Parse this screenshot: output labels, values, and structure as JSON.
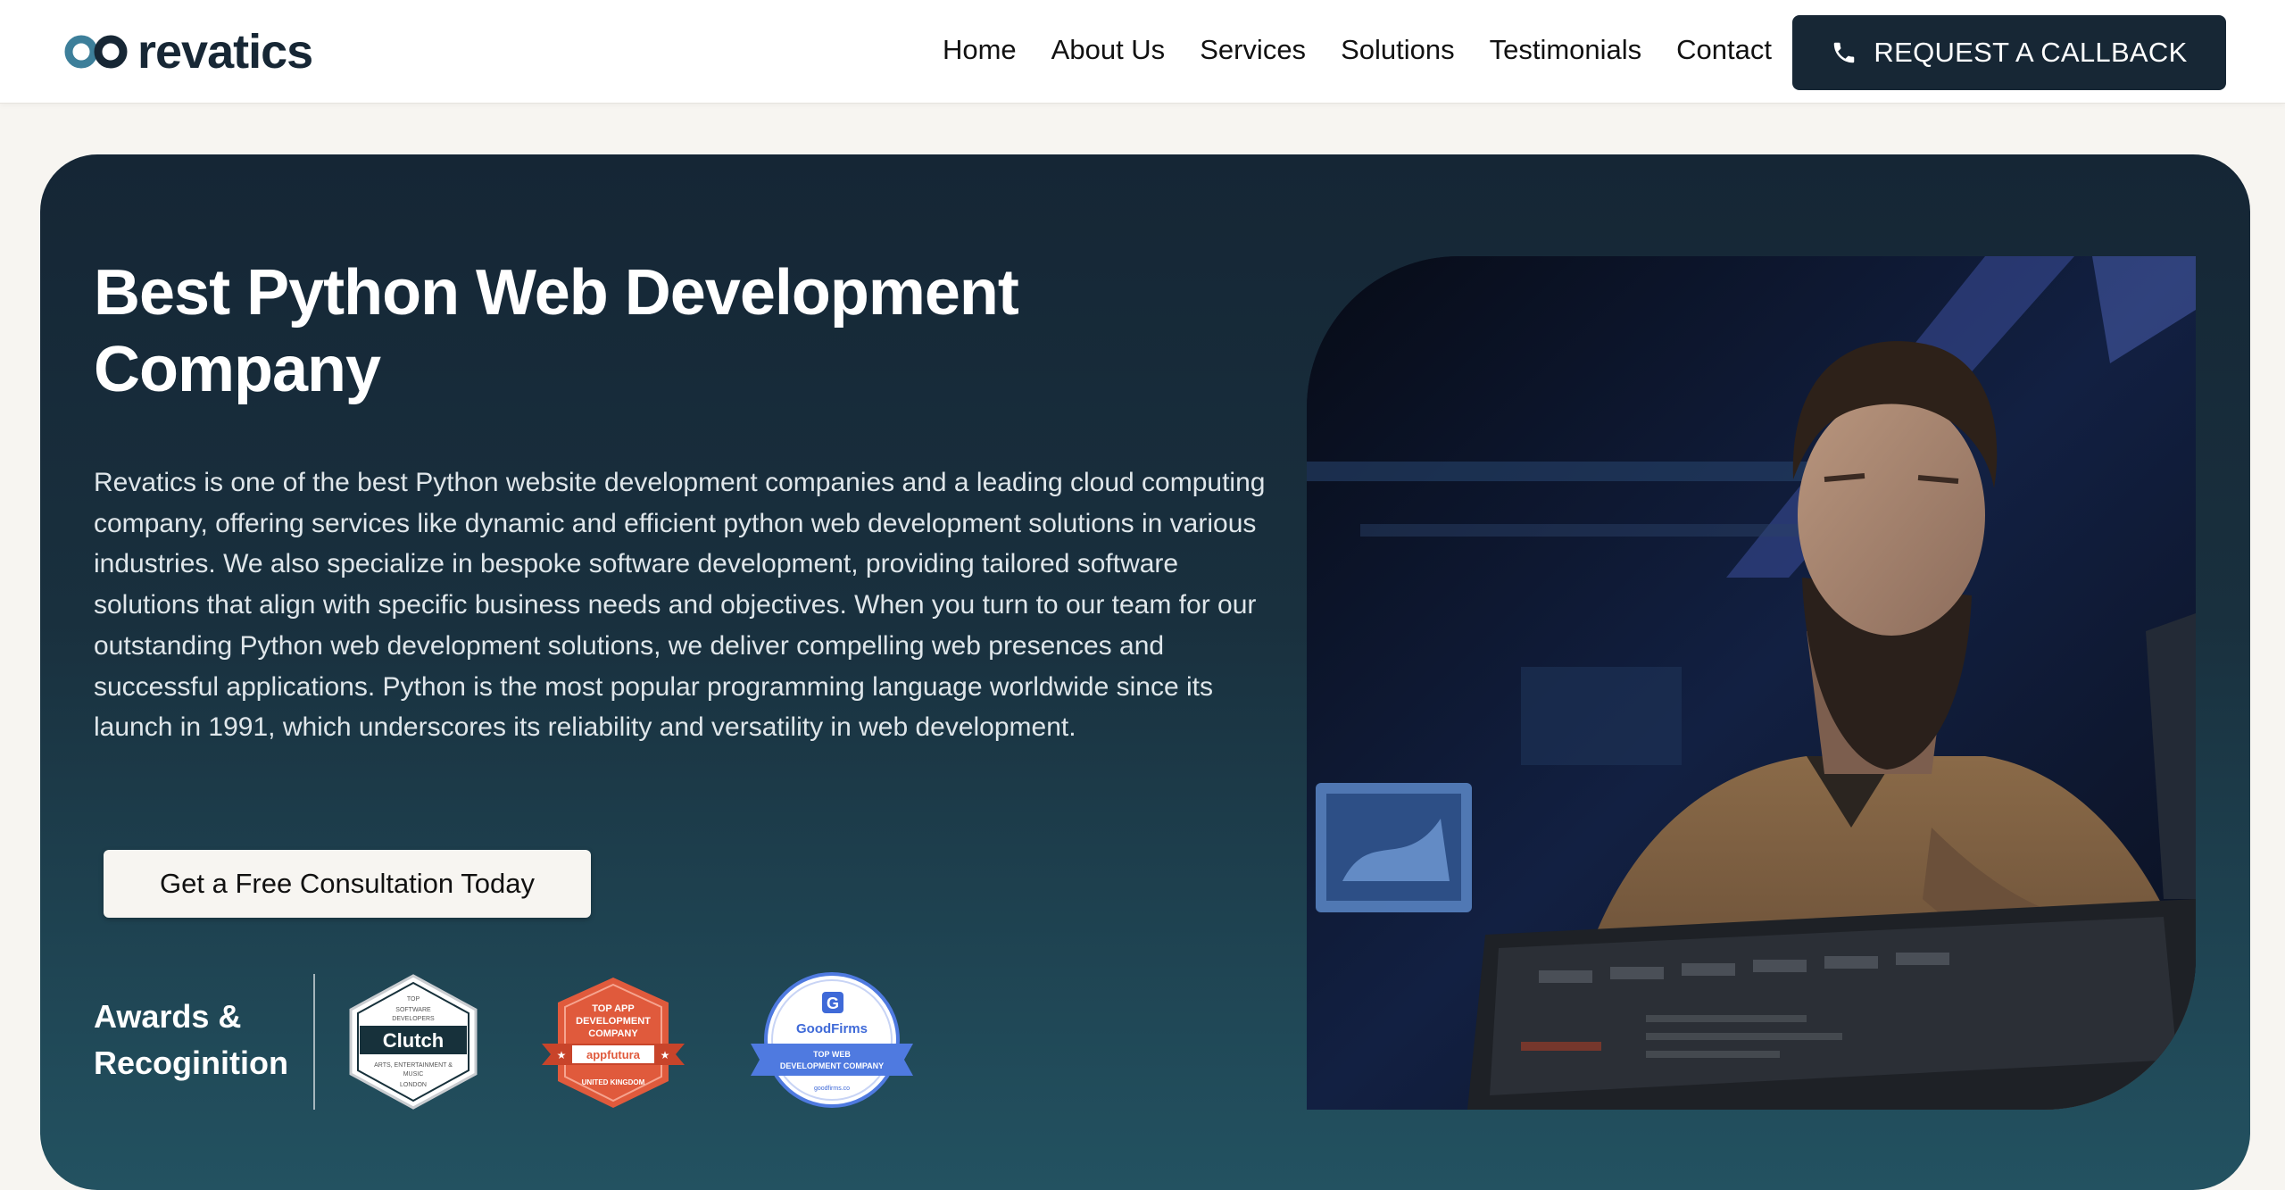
{
  "brand": {
    "name": "revatics",
    "logo_icon": "infinity-loop-icon",
    "primary_color": "#172735",
    "accent_color": "#3d7f9a"
  },
  "nav": {
    "items": [
      {
        "label": "Home"
      },
      {
        "label": "About Us"
      },
      {
        "label": "Services"
      },
      {
        "label": "Solutions"
      },
      {
        "label": "Testimonials"
      },
      {
        "label": "Contact"
      }
    ],
    "cta_label": "REQUEST A CALLBACK",
    "cta_icon": "phone-icon"
  },
  "hero": {
    "title": "Best Python Web Development Company",
    "description": "Revatics is one of the best Python website development companies and a leading cloud computing company, offering services like dynamic and efficient python web development solutions in various industries. We also specialize in bespoke software development, providing tailored software solutions that align with specific business needs and objectives. When you turn to our team for our outstanding Python web development solutions, we deliver compelling web presences and successful applications. Python is the most popular programming language worldwide since its launch in 1991, which underscores its reliability and versatility in web development.",
    "button_label": "Get a Free Consultation Today",
    "awards_label": "Awards & Recoginition",
    "image": "developer-typing-at-computer-photo"
  },
  "awards": [
    {
      "name": "clutch-badge",
      "top": "TOP",
      "line1": "SOFTWARE",
      "line2": "DEVELOPERS",
      "brand": "Clutch",
      "sub1": "ARTS, ENTERTAINMENT &",
      "sub2": "MUSIC",
      "sub3": "LONDON"
    },
    {
      "name": "appfutura-badge",
      "line1": "TOP APP",
      "line2": "DEVELOPMENT",
      "line3": "COMPANY",
      "brand": "appfutura",
      "sub": "UNITED KINGDOM"
    },
    {
      "name": "goodfirms-badge",
      "brand": "GoodFirms",
      "line1": "TOP WEB",
      "line2": "DEVELOPMENT COMPANY",
      "sub": "goodfirms.co"
    }
  ]
}
